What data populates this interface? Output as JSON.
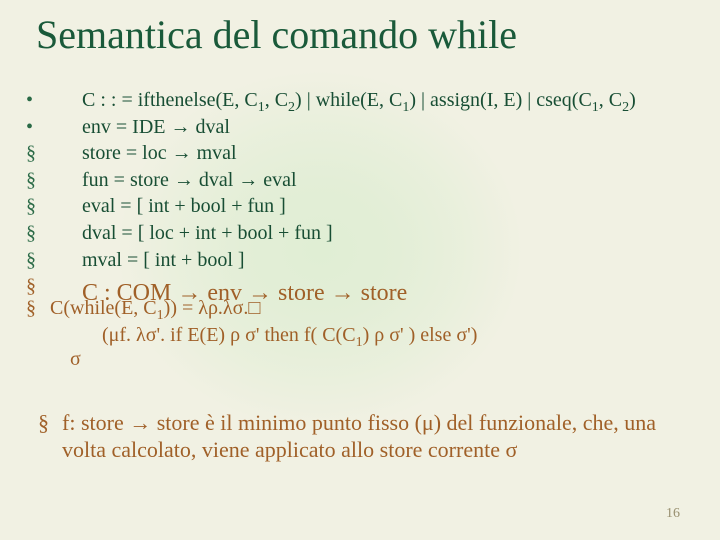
{
  "title": "Semantica del comando while",
  "bullets": {
    "b1": "•",
    "b2": "•",
    "b3": "§",
    "b4": "§",
    "b5": "§",
    "b6": "§",
    "b7": "§",
    "b8": "§",
    "b9": "§",
    "b10": "§"
  },
  "defs": {
    "l1a": "C : : = ifthenelse(E, C",
    "l1b": ", C",
    "l1c": ") | while(E, C",
    "l1d": ") | assign(I, E) | cseq(C",
    "l1e": ", C",
    "l1f": ")",
    "l2": "env = IDE → dval",
    "l3": "store = loc → mval",
    "l4": "fun = store → dval → eval",
    "l5": "eval = [ int + bool + fun ]",
    "l6": "dval = [ loc + int + bool + fun ]",
    "l7": "mval = [ int + bool ]",
    "l8": "C : COM → env → store → store"
  },
  "sem": {
    "s1a": "C(while(E, C",
    "s1b": ")) = λρ.λσ.□",
    "s2a": "(μf. λσ'. if  E(E) ρ σ' then f( C(C",
    "s2b": ") ρ σ' ) else σ')",
    "s3": "σ"
  },
  "note": "f: store → store è il minimo punto fisso (μ) del funzionale, che, una volta calcolato, viene applicato allo store corrente σ",
  "sub": {
    "one": "1",
    "two": "2"
  },
  "pagenum": "16"
}
